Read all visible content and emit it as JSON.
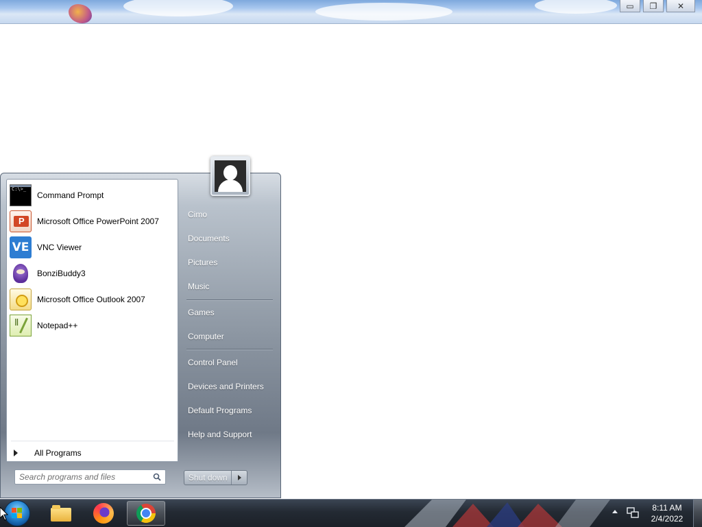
{
  "window": {
    "minimize_glyph": "▭",
    "restore_glyph": "❐",
    "close_glyph": "✕"
  },
  "start_menu": {
    "pinned_programs": [
      {
        "label": "Command Prompt",
        "icon": "command-prompt-icon"
      },
      {
        "label": "Microsoft Office PowerPoint 2007",
        "icon": "powerpoint-icon"
      },
      {
        "label": "VNC Viewer",
        "icon": "vnc-viewer-icon"
      },
      {
        "label": "BonziBuddy3",
        "icon": "bonzibuddy-icon"
      },
      {
        "label": "Microsoft Office Outlook 2007",
        "icon": "outlook-icon"
      },
      {
        "label": "Notepad++",
        "icon": "notepad-plus-plus-icon"
      }
    ],
    "vnc_icon_text": "VE",
    "all_programs_label": "All Programs",
    "search_placeholder": "Search programs and files",
    "right_items": [
      "Cimo",
      "Documents",
      "Pictures",
      "Music",
      "Games",
      "Computer",
      "Control Panel",
      "Devices and Printers",
      "Default Programs",
      "Help and Support"
    ],
    "shutdown_label": "Shut down"
  },
  "taskbar": {
    "apps": [
      "windows-explorer-icon",
      "firefox-icon",
      "chrome-icon"
    ],
    "active_app": "chrome-icon",
    "time": "8:11 AM",
    "date": "2/4/2022"
  },
  "colors": {
    "taskbar": "#1b2028",
    "start_menu_frame": "#8c96a2",
    "left_pane": "#ffffff"
  }
}
